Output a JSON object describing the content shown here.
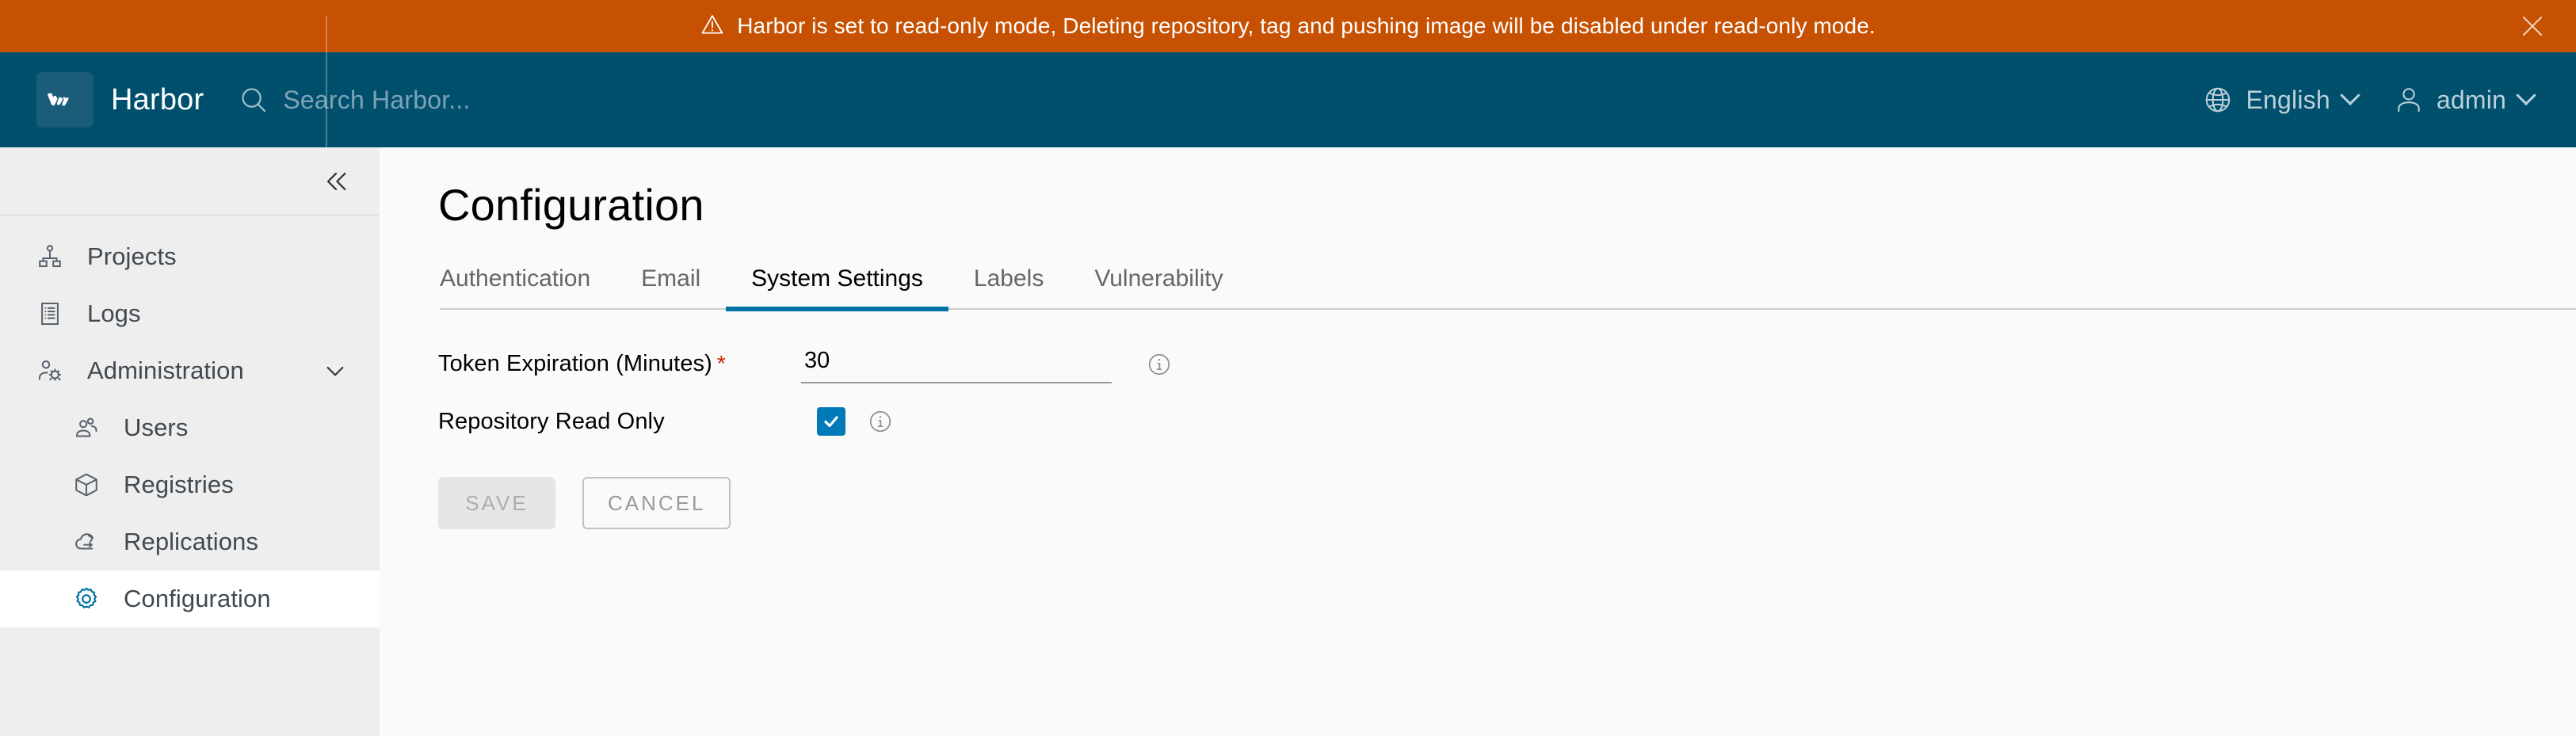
{
  "banner": {
    "icon": "warning-triangle-icon",
    "message": "Harbor is set to read-only mode, Deleting repository, tag and pushing image will be disabled under read-only mode.",
    "close_icon": "close-icon",
    "background_color": "#c65102",
    "text_color": "#ffffff"
  },
  "header": {
    "logo_text": "vm",
    "brand": "Harbor",
    "search": {
      "icon": "search-icon",
      "placeholder": "Search Harbor..."
    },
    "language": {
      "icon": "globe-icon",
      "label": "English",
      "chevron": "chevron-down-icon"
    },
    "account": {
      "icon": "user-icon",
      "label": "admin",
      "chevron": "chevron-down-icon"
    },
    "background_color": "#00506d"
  },
  "sidebar": {
    "collapse_icon": "double-chevron-left-icon",
    "items": [
      {
        "label": "Projects",
        "icon": "projects-icon",
        "level": "top",
        "active": false,
        "expandable": false
      },
      {
        "label": "Logs",
        "icon": "logs-icon",
        "level": "top",
        "active": false,
        "expandable": false
      },
      {
        "label": "Administration",
        "icon": "administration-icon",
        "level": "top",
        "active": false,
        "expandable": true,
        "chevron": "chevron-down-icon"
      },
      {
        "label": "Users",
        "icon": "users-icon",
        "level": "sub",
        "active": false,
        "expandable": false
      },
      {
        "label": "Registries",
        "icon": "registries-icon",
        "level": "sub",
        "active": false,
        "expandable": false
      },
      {
        "label": "Replications",
        "icon": "replications-icon",
        "level": "sub",
        "active": false,
        "expandable": false
      },
      {
        "label": "Configuration",
        "icon": "configuration-gear-icon",
        "level": "sub",
        "active": true,
        "expandable": false
      }
    ],
    "background_color": "#eeeeee",
    "active_background_color": "#ffffff",
    "active_icon_color": "#0072a3"
  },
  "main": {
    "page_title": "Configuration",
    "tabs": [
      {
        "label": "Authentication",
        "active": false
      },
      {
        "label": "Email",
        "active": false
      },
      {
        "label": "System Settings",
        "active": true
      },
      {
        "label": "Labels",
        "active": false
      },
      {
        "label": "Vulnerability",
        "active": false
      }
    ],
    "active_tab_color": "#0072a3",
    "form": {
      "token_expiration": {
        "label": "Token Expiration (Minutes)",
        "required_marker": "*",
        "value": "30",
        "placeholder": "",
        "info_icon": "info-circle-icon"
      },
      "repository_read_only": {
        "label": "Repository Read Only",
        "checked": true,
        "checkbox_color": "#0079b8",
        "info_icon": "info-circle-icon"
      },
      "buttons": {
        "save": "SAVE",
        "cancel": "CANCEL",
        "save_disabled": true
      }
    }
  }
}
